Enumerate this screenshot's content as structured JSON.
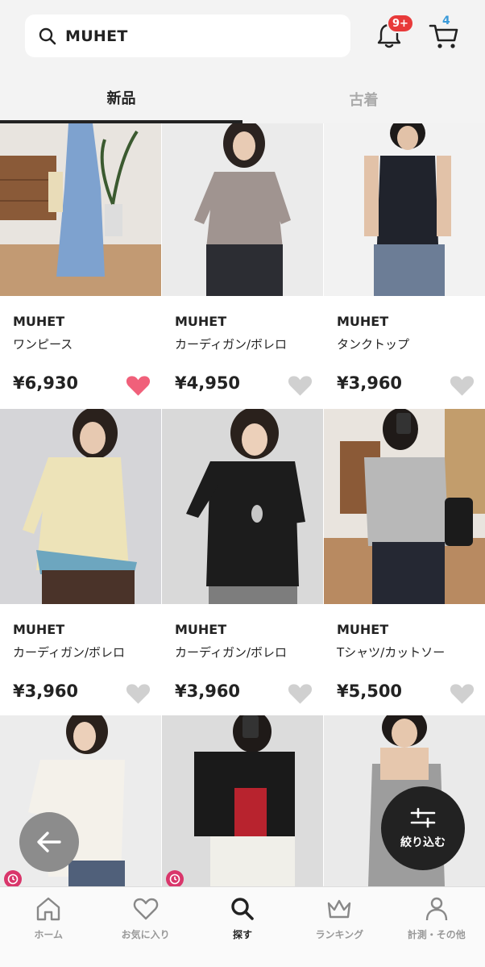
{
  "search": {
    "value": "MUHET"
  },
  "notifications": {
    "badge": "9+"
  },
  "cart": {
    "count": "4"
  },
  "tabs": [
    {
      "label": "新品",
      "active": true
    },
    {
      "label": "古着",
      "active": false
    }
  ],
  "products": [
    {
      "brand": "MUHET",
      "category": "ワンピース",
      "price": "¥6,930",
      "favorited": true
    },
    {
      "brand": "MUHET",
      "category": "カーディガン/ボレロ",
      "price": "¥4,950",
      "favorited": false
    },
    {
      "brand": "MUHET",
      "category": "タンクトップ",
      "price": "¥3,960",
      "favorited": false
    },
    {
      "brand": "MUHET",
      "category": "カーディガン/ボレロ",
      "price": "¥3,960",
      "favorited": false
    },
    {
      "brand": "MUHET",
      "category": "カーディガン/ボレロ",
      "price": "¥3,960",
      "favorited": false
    },
    {
      "brand": "MUHET",
      "category": "Tシャツ/カットソー",
      "price": "¥5,500",
      "favorited": false
    }
  ],
  "filter": {
    "label": "絞り込む"
  },
  "nav": [
    {
      "label": "ホーム",
      "icon": "home-icon"
    },
    {
      "label": "お気に入り",
      "icon": "heart-icon"
    },
    {
      "label": "探す",
      "icon": "search-icon",
      "active": true
    },
    {
      "label": "ランキング",
      "icon": "crown-icon"
    },
    {
      "label": "計測・その他",
      "icon": "person-icon"
    }
  ],
  "colors": {
    "accent_red": "#e83a3a",
    "heart_pink": "#f0607a",
    "cart_blue": "#3a9ad9",
    "clock_pink": "#d9366b"
  }
}
